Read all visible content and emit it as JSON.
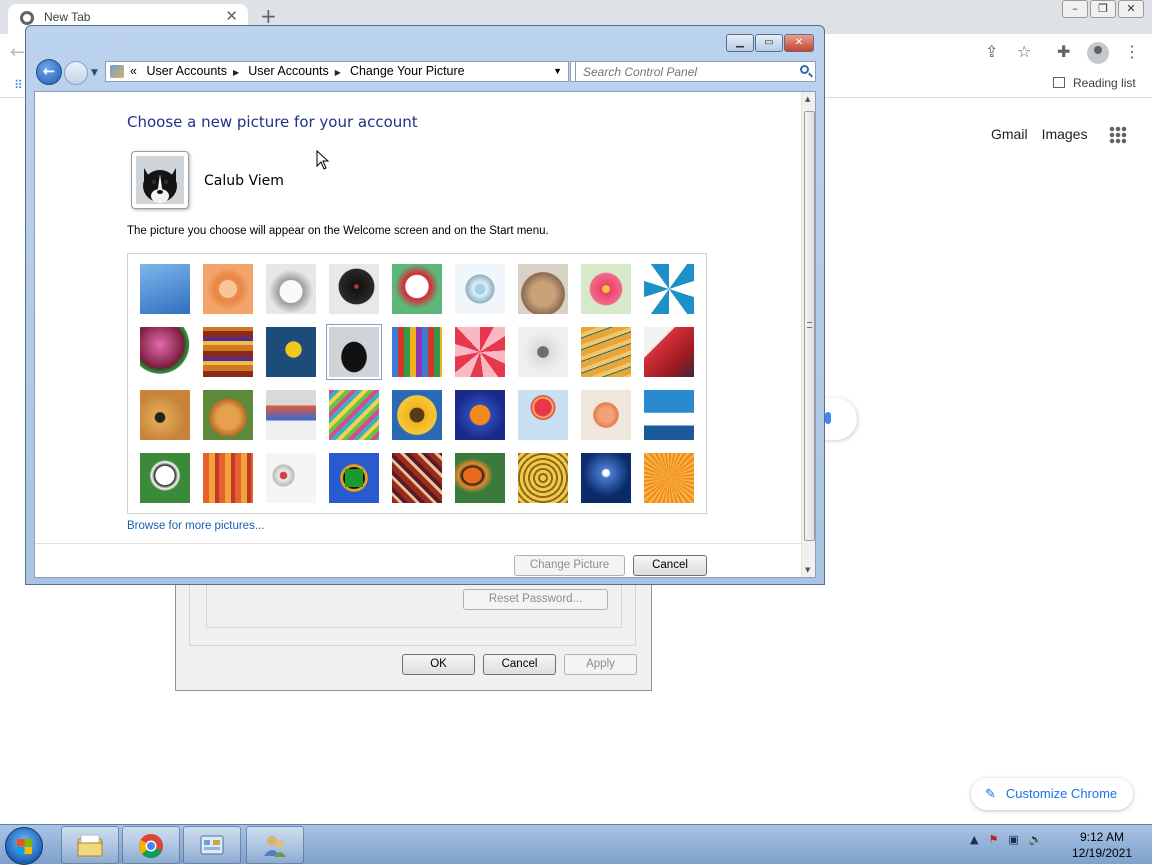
{
  "chrome": {
    "tab_title": "New Tab",
    "reading_list": "Reading list",
    "google_links": [
      "Gmail",
      "Images"
    ],
    "customize_label": "Customize Chrome"
  },
  "background_dialog": {
    "reset_password": "Reset Password...",
    "ok": "OK",
    "cancel": "Cancel",
    "apply": "Apply"
  },
  "window": {
    "breadcrumbs": [
      "User Accounts",
      "User Accounts",
      "Change Your Picture"
    ],
    "search_placeholder": "Search Control Panel"
  },
  "page": {
    "title": "Choose a new picture for your account",
    "user_name": "Calub Viem",
    "description": "The picture you choose will appear on the Welcome screen and on the Start menu.",
    "browse_link": "Browse for more pictures...",
    "change_picture": "Change Picture",
    "cancel": "Cancel",
    "selected_picture": "dog"
  },
  "pictures": [
    [
      "roller-coaster",
      "starfish",
      "robot-dog",
      "record",
      "lucky-cat",
      "gyroscope",
      "kitten",
      "pink-flower",
      "pinwheel"
    ],
    [
      "ball",
      "fabric-stripes",
      "leaf",
      "dog",
      "crayons",
      "red-star",
      "jacks",
      "stairs",
      "paper-crane"
    ],
    [
      "guitar",
      "puppy",
      "toy-robot",
      "hammock",
      "sunflower",
      "fish",
      "balloon",
      "doll",
      "sailboat"
    ],
    [
      "soccer-ball",
      "orange-stripes",
      "marbles",
      "window",
      "rug",
      "butterfly",
      "basket",
      "lighthouse",
      "orange-flower"
    ]
  ],
  "taskbar": {
    "time": "9:12 AM",
    "date": "12/19/2021",
    "apps": [
      "explorer-icon",
      "chrome-icon",
      "control-panel-icon",
      "user-accounts-icon"
    ]
  }
}
